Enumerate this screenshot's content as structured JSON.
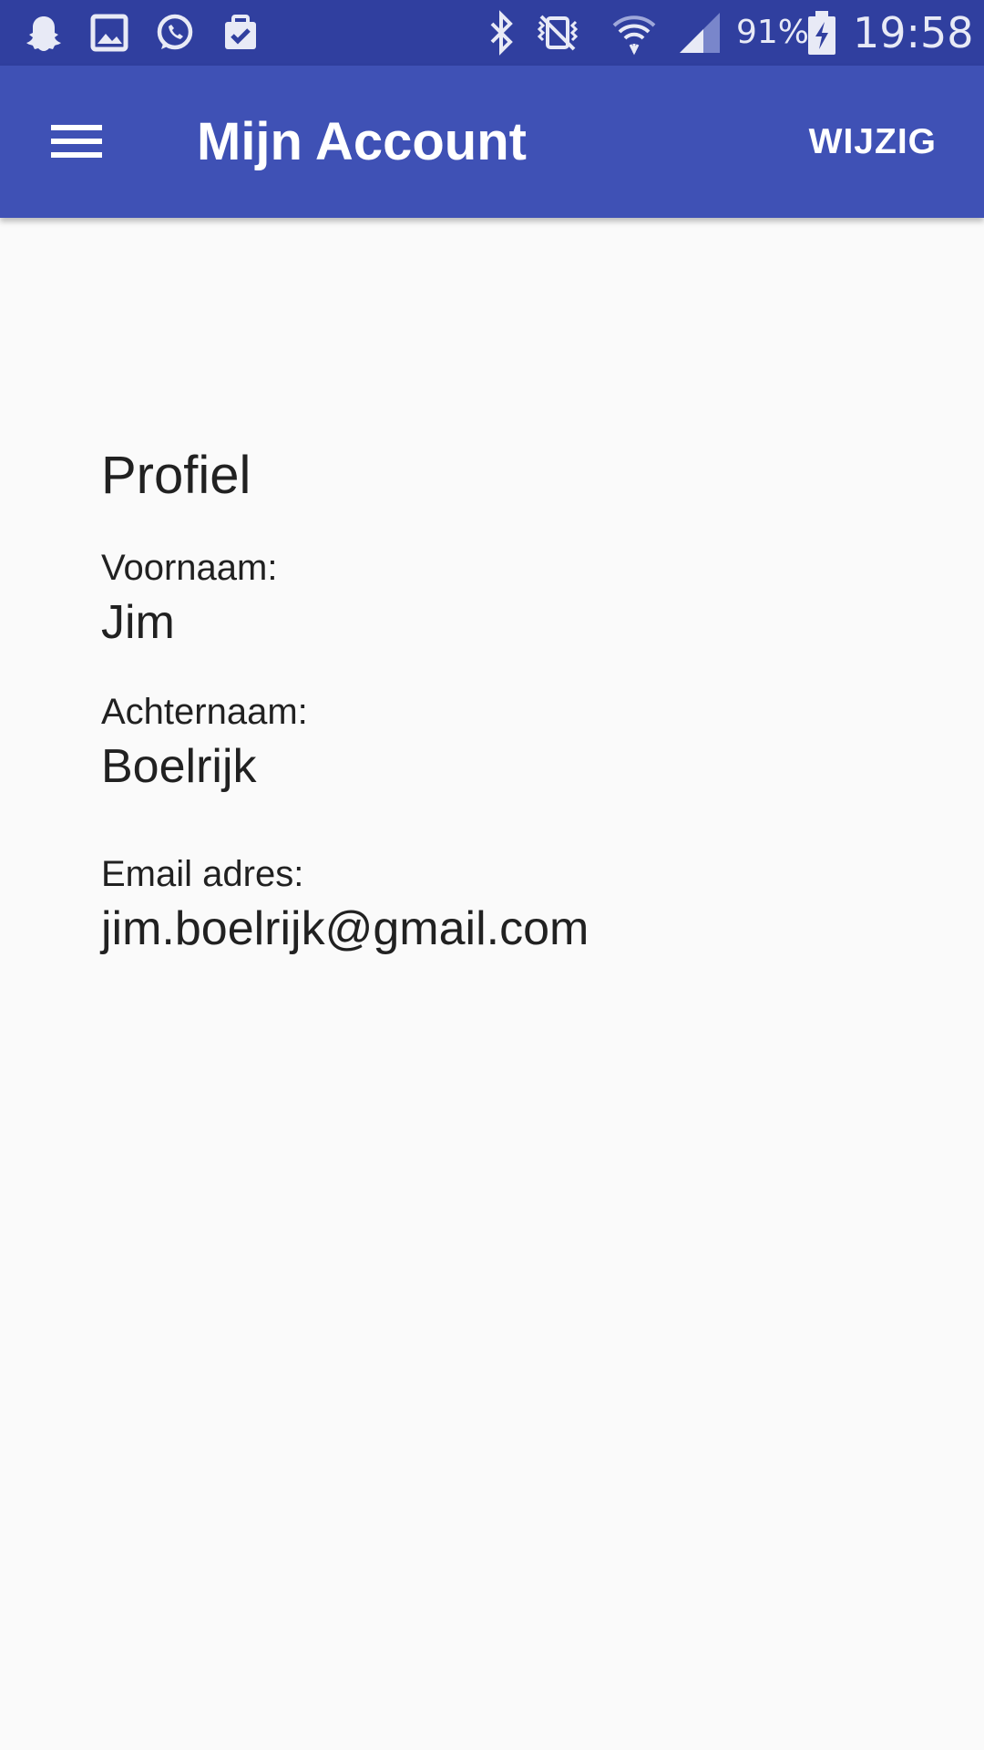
{
  "status_bar": {
    "battery": "91%",
    "time": "19:58",
    "left_icons": [
      "snapchat-ghost-icon",
      "image-icon",
      "whatsapp-icon",
      "clipboard-check-icon"
    ],
    "right_icons": [
      "bluetooth-icon",
      "vibrate-off-icon",
      "wifi-icon",
      "cell-signal-icon",
      "battery-charging-icon"
    ]
  },
  "app_bar": {
    "title": "Mijn Account",
    "action_label": "WIJZIG",
    "menu_icon": "hamburger-menu-icon"
  },
  "profile": {
    "section_title": "Profiel",
    "fields": [
      {
        "label": "Voornaam:",
        "value": "Jim"
      },
      {
        "label": "Achternaam:",
        "value": "Boelrijk"
      },
      {
        "label": "Email adres:",
        "value": "jim.boelrijk@gmail.com"
      }
    ]
  },
  "colors": {
    "status_bar": "#303f9f",
    "app_bar": "#3f51b5",
    "background": "#fafafa",
    "text_primary": "#212121"
  }
}
